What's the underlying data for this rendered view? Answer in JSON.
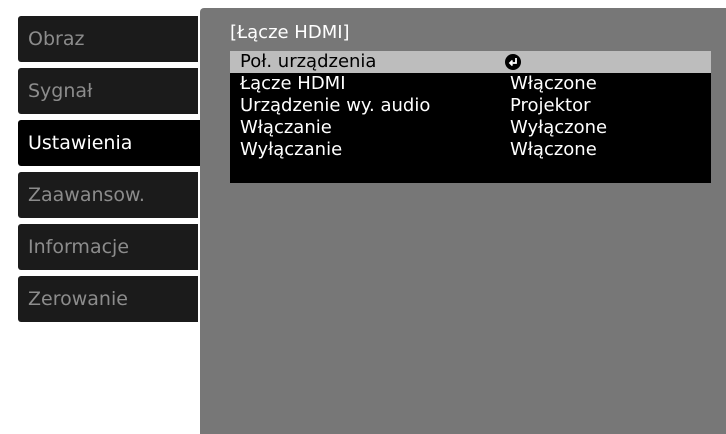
{
  "sidebar": {
    "items": [
      {
        "label": "Obraz"
      },
      {
        "label": "Sygnał"
      },
      {
        "label": "Ustawienia"
      },
      {
        "label": "Zaawansow."
      },
      {
        "label": "Informacje"
      },
      {
        "label": "Zerowanie"
      }
    ],
    "active_index": 2
  },
  "panel": {
    "title": "[Łącze HDMI]",
    "rows": [
      {
        "label": "Poł. urządzenia",
        "value": "",
        "icon": "enter-icon",
        "selected": true
      },
      {
        "label": "Łącze HDMI",
        "value": "Włączone"
      },
      {
        "label": "Urządzenie wy. audio",
        "value": "Projektor"
      },
      {
        "label": "Włączanie",
        "value": "Wyłączone"
      },
      {
        "label": "Wyłączanie",
        "value": "Włączone"
      }
    ]
  },
  "colors": {
    "panel_bg": "#777777",
    "tab_bg": "#1b1b1b",
    "tab_active_bg": "#000000",
    "selected_row_bg": "#bdbdbd"
  }
}
